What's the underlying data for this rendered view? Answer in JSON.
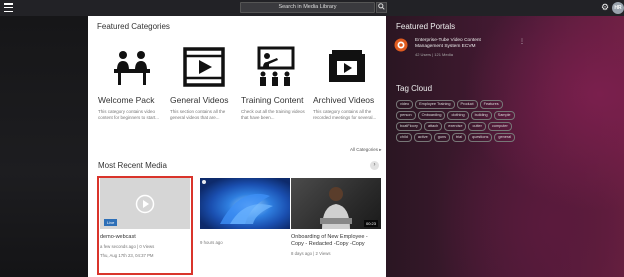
{
  "topbar": {
    "search_placeholder": "Search in Media Library",
    "search_icon": "magnifier-icon",
    "settings_icon": "gear-icon",
    "avatar_initials": "HR"
  },
  "featured_categories": {
    "title": "Featured Categories",
    "all_link": "All Categories ▸",
    "items": [
      {
        "name": "Welcome Pack",
        "desc": "This category contains video content for beginners to start...",
        "icon": "meeting-icon"
      },
      {
        "name": "General Videos",
        "desc": "This section contains all the general videos that are...",
        "icon": "video-player-icon"
      },
      {
        "name": "Training Content",
        "desc": "Check out all the training videos that have been...",
        "icon": "presentation-icon"
      },
      {
        "name": "Archived Videos",
        "desc": "This category contains all the recorded meetings for several...",
        "icon": "archive-player-icon"
      }
    ]
  },
  "recent_media": {
    "title": "Most Recent Media",
    "items": [
      {
        "title": "demo-webcast",
        "meta1": "a few seconds ago | 0 Views",
        "meta2": "Thu, Aug 17th 23, 04:37 PM",
        "badge": "Live"
      },
      {
        "title": "",
        "meta1": "9 hours ago",
        "meta2": ""
      },
      {
        "title": "Onboarding of New Employee - Copy - Redacted -Copy -Copy",
        "meta1": "8 days ago | 2 Views",
        "meta2": "",
        "duration": "00:23"
      }
    ]
  },
  "featured_portals": {
    "title": "Featured Portals",
    "portal_name": "Enterprise-Tube Video Content Management System ECVM",
    "portal_meta": "42 Users | 121 Media"
  },
  "tag_cloud": {
    "title": "Tag Cloud",
    "tags": [
      "video",
      "Employee Training",
      "Product",
      "Features",
      "person",
      "Onboarding",
      "clothing",
      "building",
      "Sample",
      "boatFloory",
      "attach",
      "exercise",
      "cutter",
      "computer",
      "child",
      "active",
      "guns",
      "trial",
      "questions",
      "general"
    ]
  },
  "colors": {
    "selection": "#d9342b",
    "live_badge": "#2d6fb7"
  }
}
